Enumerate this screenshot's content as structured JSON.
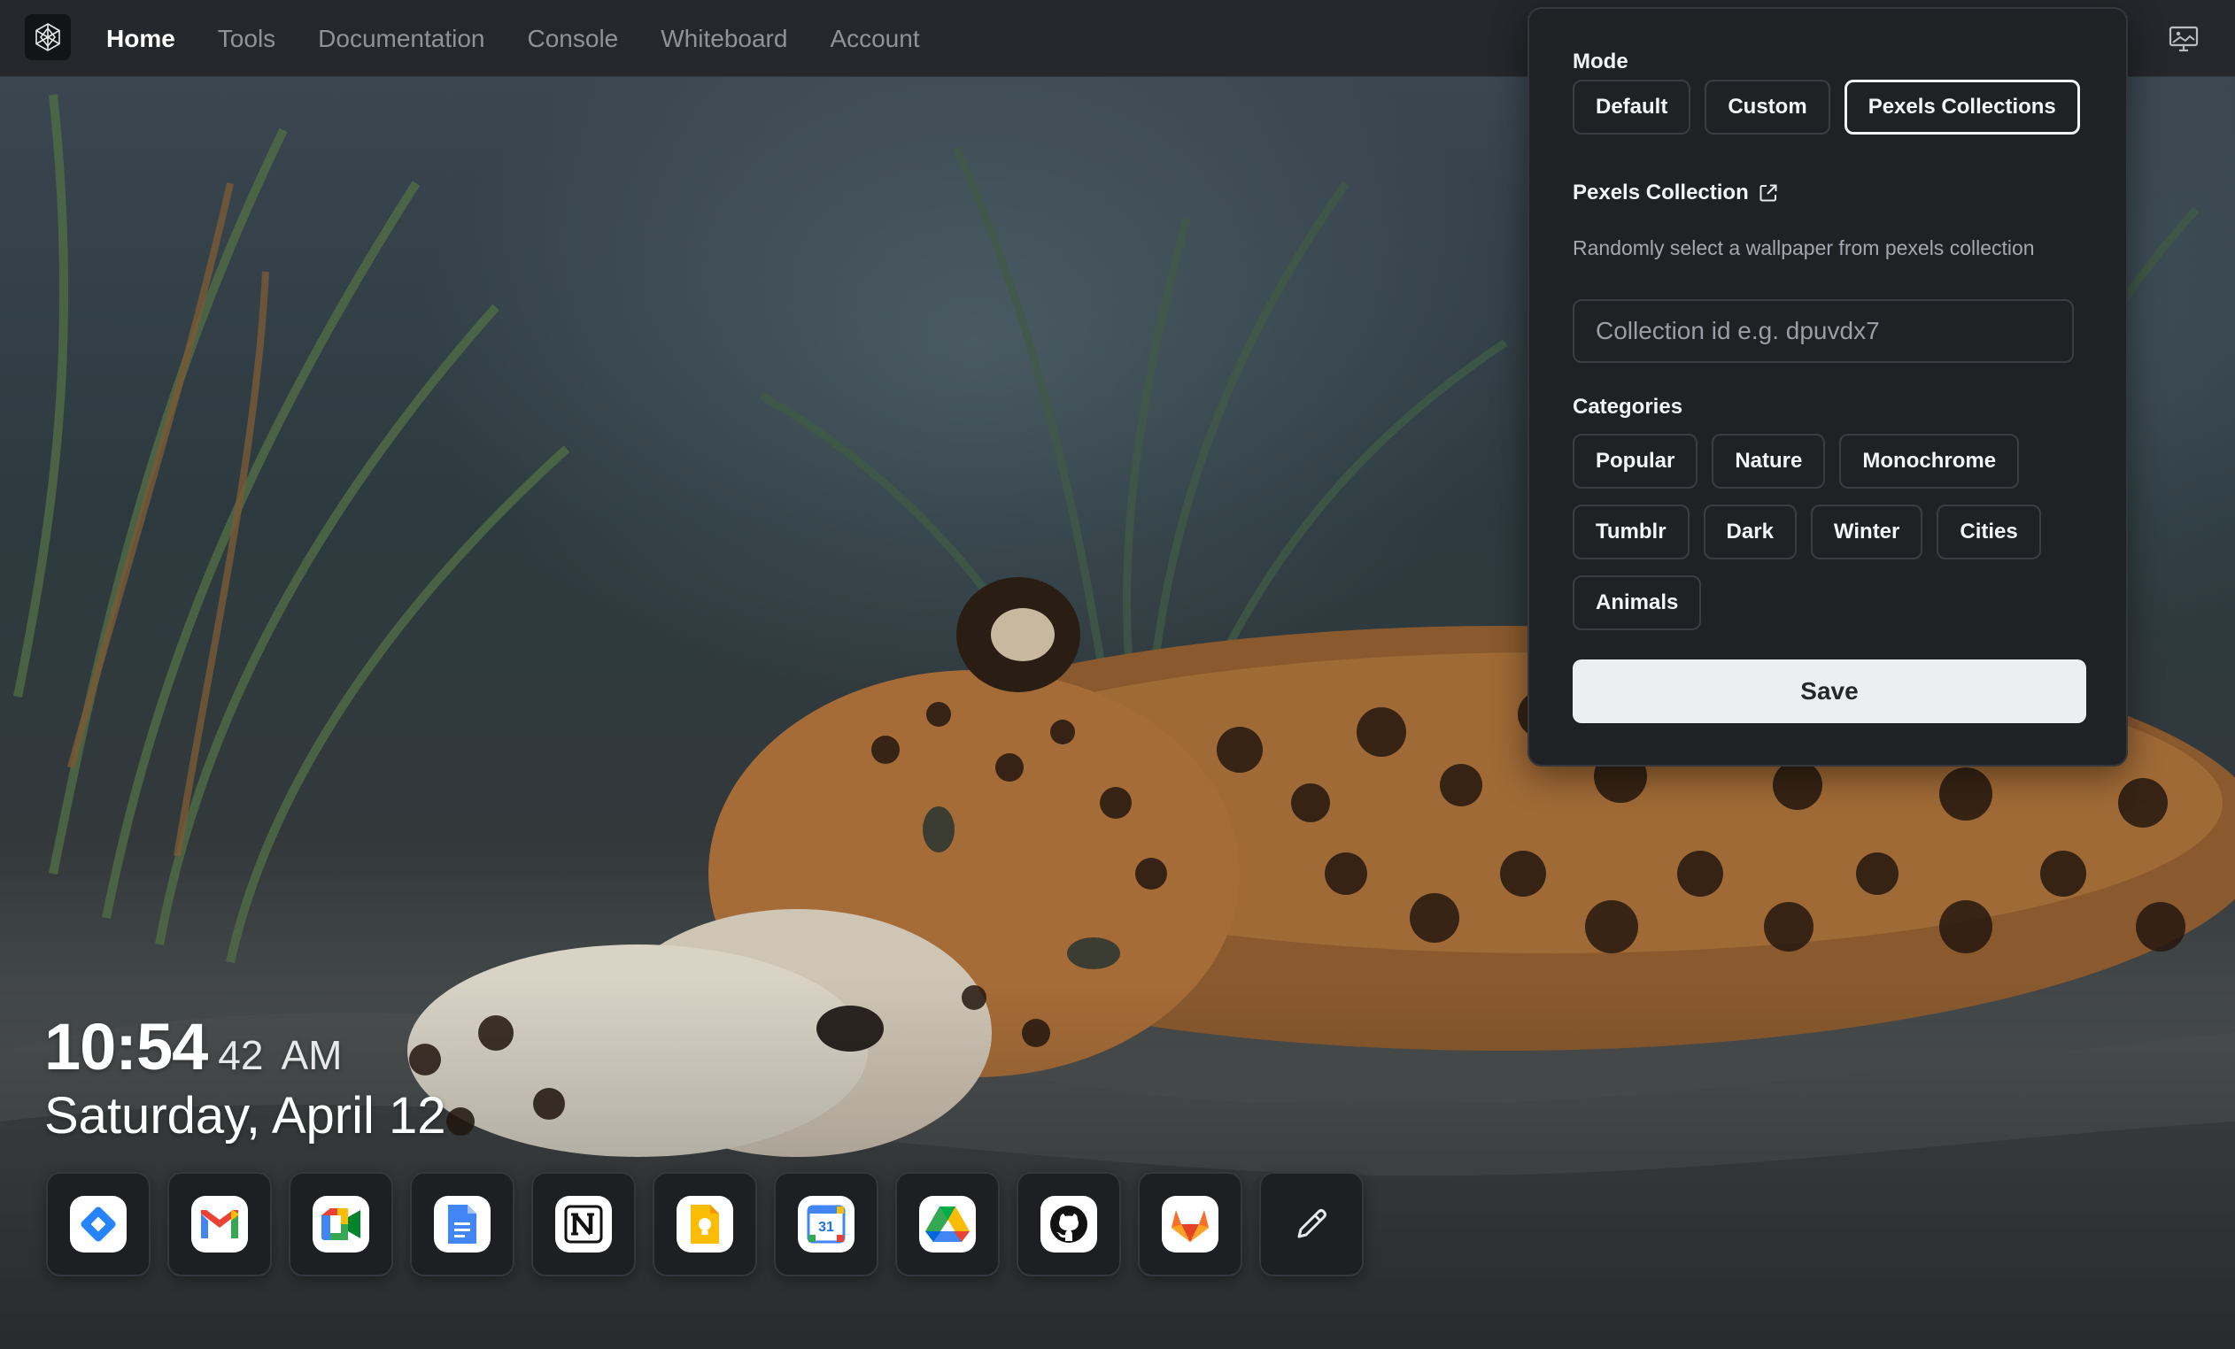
{
  "nav": {
    "items": [
      {
        "label": "Home",
        "active": true
      },
      {
        "label": "Tools",
        "active": false
      },
      {
        "label": "Documentation",
        "active": false
      },
      {
        "label": "Console",
        "active": false
      },
      {
        "label": "Whiteboard",
        "active": false
      },
      {
        "label": "Account",
        "active": false
      }
    ],
    "logo_icon": "geometric-logo-icon",
    "right_icon": "monitor-image-icon"
  },
  "panel": {
    "mode_label": "Mode",
    "modes": [
      "Default",
      "Custom",
      "Pexels Collections"
    ],
    "selected_mode": "Pexels Collections",
    "collection_label": "Pexels Collection",
    "collection_link_icon": "external-link-icon",
    "collection_description": "Randomly select a wallpaper from pexels collection",
    "collection_input": {
      "value": "",
      "placeholder": "Collection id e.g. dpuvdx7"
    },
    "categories_label": "Categories",
    "categories": [
      [
        "Popular",
        "Nature",
        "Monochrome"
      ],
      [
        "Tumblr",
        "Dark",
        "Winter",
        "Cities"
      ],
      [
        "Animals"
      ]
    ],
    "save_label": "Save"
  },
  "clock": {
    "hm": "10:54",
    "seconds": "42",
    "ampm": "AM",
    "date": "Saturday, April 12"
  },
  "dock": [
    {
      "name": "jira",
      "icon": "jira-icon"
    },
    {
      "name": "gmail",
      "icon": "gmail-icon"
    },
    {
      "name": "google-meet",
      "icon": "google-meet-icon"
    },
    {
      "name": "google-docs",
      "icon": "google-docs-icon"
    },
    {
      "name": "notion",
      "icon": "notion-icon"
    },
    {
      "name": "google-keep",
      "icon": "google-keep-icon"
    },
    {
      "name": "google-calendar",
      "icon": "google-calendar-icon",
      "text": "31"
    },
    {
      "name": "google-drive",
      "icon": "google-drive-icon"
    },
    {
      "name": "github",
      "icon": "github-icon"
    },
    {
      "name": "gitlab",
      "icon": "gitlab-icon"
    },
    {
      "name": "edit",
      "icon": "pencil-icon"
    }
  ],
  "colors": {
    "topbar": "#25272c",
    "panel": "#1f2125",
    "save_button": "#eceef1",
    "nav_active": "#ffffff",
    "nav_inactive": "#8e939b"
  }
}
